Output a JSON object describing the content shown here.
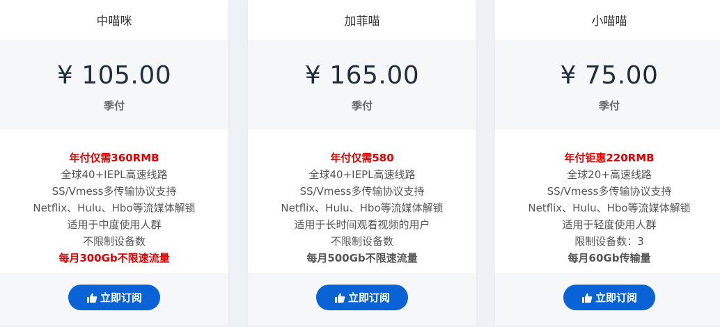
{
  "plans": [
    {
      "name": "中喵咪",
      "price": "¥ 105.00",
      "period": "季付",
      "features": [
        {
          "text": "年付仅需360RMB",
          "style": "highlight"
        },
        {
          "text": "全球40+IEPL高速线路",
          "style": "normal"
        },
        {
          "text": "SS/Vmess多传输协议支持",
          "style": "normal"
        },
        {
          "text": "Netflix、Hulu、Hbo等流媒体解锁",
          "style": "normal"
        },
        {
          "text": "适用于中度使用人群",
          "style": "normal"
        },
        {
          "text": "不限制设备数",
          "style": "normal"
        },
        {
          "text": "每月300Gb不限速流量",
          "style": "strong-red"
        }
      ],
      "button_label": "立即订阅",
      "button_icon": "thumbs-up-icon"
    },
    {
      "name": "加菲喵",
      "price": "¥ 165.00",
      "period": "季付",
      "features": [
        {
          "text": "年付仅需580",
          "style": "highlight"
        },
        {
          "text": "全球40+IEPL高速线路",
          "style": "normal"
        },
        {
          "text": "SS/Vmess多传输协议支持",
          "style": "normal"
        },
        {
          "text": "Netflix、Hulu、Hbo等流媒体解锁",
          "style": "normal"
        },
        {
          "text": "适用于长时间观看视频的用户",
          "style": "normal"
        },
        {
          "text": "不限制设备数",
          "style": "normal"
        },
        {
          "text": "每月500Gb不限速流量",
          "style": "strong"
        }
      ],
      "button_label": "立即订阅",
      "button_icon": "thumbs-up-icon"
    },
    {
      "name": "小喵喵",
      "price": "¥ 75.00",
      "period": "季付",
      "features": [
        {
          "text": "年付钜惠220RMB",
          "style": "highlight"
        },
        {
          "text": "全球20+高速线路",
          "style": "normal"
        },
        {
          "text": "SS/Vmess多传输协议支持",
          "style": "normal"
        },
        {
          "text": "Netflix、Hulu、Hbo等流媒体解锁",
          "style": "normal"
        },
        {
          "text": "适用于轻度使用人群",
          "style": "normal"
        },
        {
          "text": "限制设备数：3",
          "style": "normal"
        },
        {
          "text": "每月60Gb传输量",
          "style": "strong"
        }
      ],
      "button_label": "立即订阅",
      "button_icon": "thumbs-up-icon"
    }
  ],
  "colors": {
    "accent": "#0a63d6",
    "highlight": "#e60000",
    "price_text": "#1f2d3d",
    "panel_bg": "#f6f7f9",
    "page_bg": "#eef1f6"
  }
}
